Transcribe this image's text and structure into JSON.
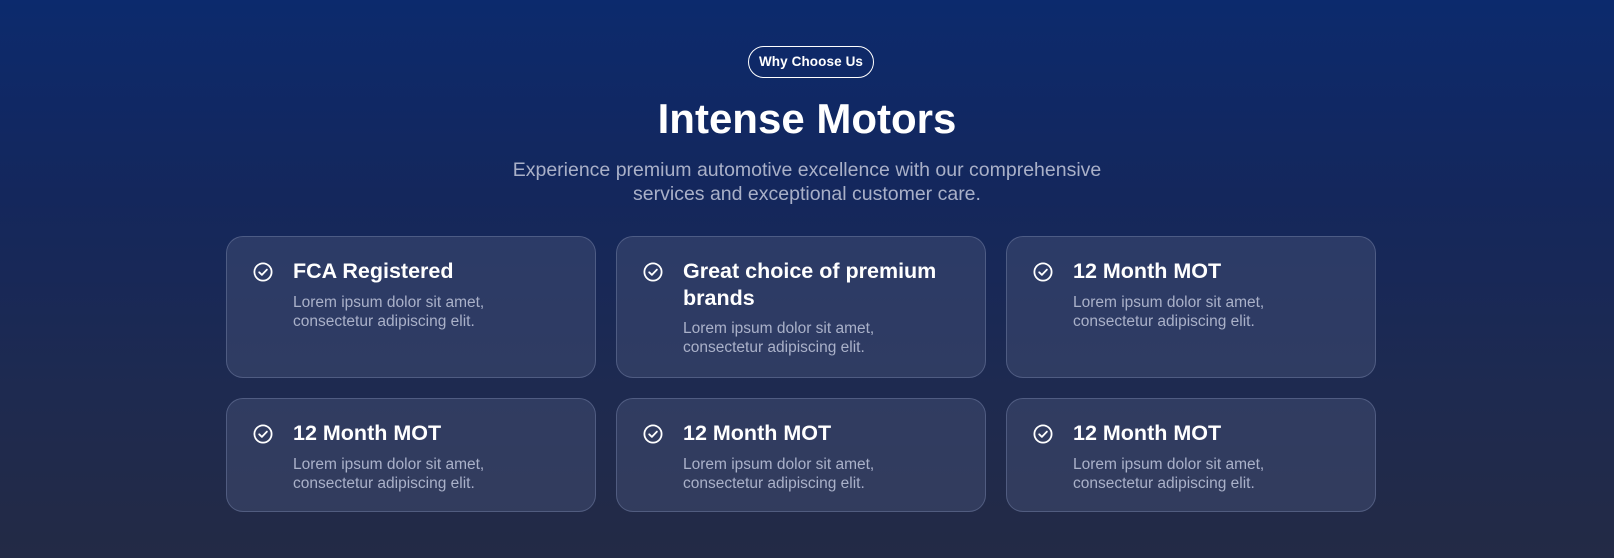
{
  "badge": "Why Choose Us",
  "title": "Intense Motors",
  "subtitle": "Experience premium automotive excellence with our comprehensive services and exceptional customer care.",
  "cards": [
    {
      "icon": "check-circle-icon",
      "title": "FCA Registered",
      "text": "Lorem ipsum dolor sit amet, consectetur adipiscing elit."
    },
    {
      "icon": "check-circle-icon",
      "title": "Great choice of premium brands",
      "text": "Lorem ipsum dolor sit amet, consectetur adipiscing elit."
    },
    {
      "icon": "check-circle-icon",
      "title": "12 Month MOT",
      "text": "Lorem ipsum dolor sit amet, consectetur adipiscing elit."
    },
    {
      "icon": "check-circle-icon",
      "title": "12 Month MOT",
      "text": "Lorem ipsum dolor sit amet, consectetur adipiscing elit."
    },
    {
      "icon": "check-circle-icon",
      "title": "12 Month MOT",
      "text": "Lorem ipsum dolor sit amet, consectetur adipiscing elit."
    },
    {
      "icon": "check-circle-icon",
      "title": "12 Month MOT",
      "text": "Lorem ipsum dolor sit amet, consectetur adipiscing elit."
    }
  ]
}
